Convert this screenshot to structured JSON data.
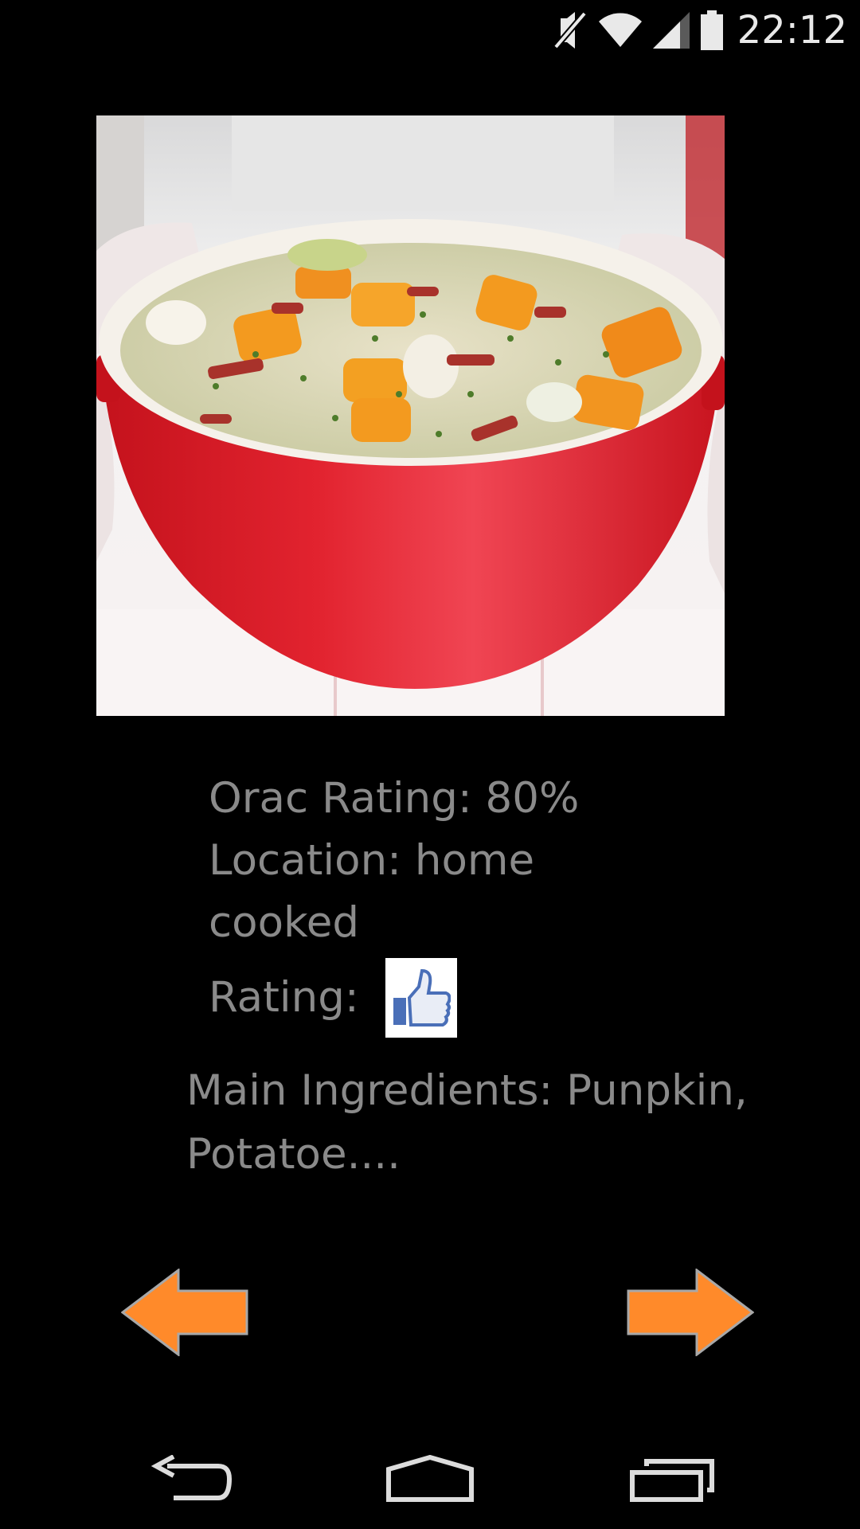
{
  "status_bar": {
    "time": "22:12",
    "icons": [
      "mute-icon",
      "wifi-icon",
      "signal-icon",
      "battery-icon"
    ]
  },
  "dish": {
    "image_icon": "stew-pot-photo",
    "orac_rating": "Orac Rating: 80%",
    "location_line1": "Location: home",
    "location_line2": "cooked",
    "rating_label": "Rating:",
    "rating_icon": "thumbs-up-icon",
    "ingredients_line1": "Main Ingredients: Punpkin,",
    "ingredients_line2": "Potatoe...."
  },
  "navigation": {
    "prev_icon": "arrow-left-icon",
    "next_icon": "arrow-right-icon",
    "arrow_color": "#ff8a2a"
  },
  "system_nav": {
    "back_icon": "back-icon",
    "home_icon": "home-icon",
    "recents_icon": "recents-icon"
  }
}
